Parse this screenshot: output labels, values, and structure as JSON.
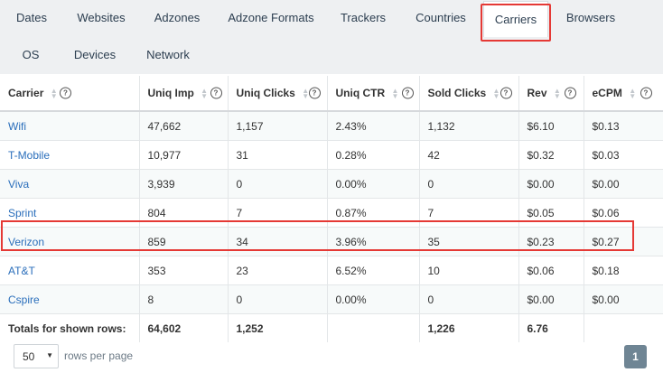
{
  "tabs": [
    {
      "label": "Dates"
    },
    {
      "label": "Websites"
    },
    {
      "label": "Adzones"
    },
    {
      "label": "Adzone Formats"
    },
    {
      "label": "Trackers"
    },
    {
      "label": "Countries"
    },
    {
      "label": "Carriers",
      "active": true
    },
    {
      "label": "Browsers"
    },
    {
      "label": "OS"
    },
    {
      "label": "Devices"
    },
    {
      "label": "Network"
    }
  ],
  "table": {
    "columns": [
      {
        "label": "Carrier",
        "sortable": true,
        "help": "?"
      },
      {
        "label": "Uniq Imp",
        "sortable": true,
        "help": "?"
      },
      {
        "label": "Uniq Clicks",
        "sortable": true,
        "help": "?"
      },
      {
        "label": "Uniq CTR",
        "sortable": true,
        "help": "?"
      },
      {
        "label": "Sold Clicks",
        "sortable": true,
        "help": "?"
      },
      {
        "label": "Rev",
        "sortable": true,
        "help": "?"
      },
      {
        "label": "eCPM",
        "sortable": true,
        "help": "?"
      }
    ],
    "rows": [
      [
        "Wifi",
        "47,662",
        "1,157",
        "2.43%",
        "1,132",
        "$6.10",
        "$0.13"
      ],
      [
        "T-Mobile",
        "10,977",
        "31",
        "0.28%",
        "42",
        "$0.32",
        "$0.03"
      ],
      [
        "Viva",
        "3,939",
        "0",
        "0.00%",
        "0",
        "$0.00",
        "$0.00"
      ],
      [
        "Sprint",
        "804",
        "7",
        "0.87%",
        "7",
        "$0.05",
        "$0.06"
      ],
      [
        "Verizon",
        "859",
        "34",
        "3.96%",
        "35",
        "$0.23",
        "$0.27"
      ],
      [
        "AT&T",
        "353",
        "23",
        "6.52%",
        "10",
        "$0.06",
        "$0.18"
      ],
      [
        "Cspire",
        "8",
        "0",
        "0.00%",
        "0",
        "$0.00",
        "$0.00"
      ]
    ],
    "totals": [
      "Totals for shown rows:",
      "64,602",
      "1,252",
      "",
      "1,226",
      "6.76",
      ""
    ]
  },
  "pager": {
    "rows_per_page": "50",
    "rows_label": "rows per page",
    "current_page": "1"
  },
  "colors": {
    "highlight": "#e53935",
    "link": "#2a6ebb",
    "pager_active": "#6f8594"
  }
}
